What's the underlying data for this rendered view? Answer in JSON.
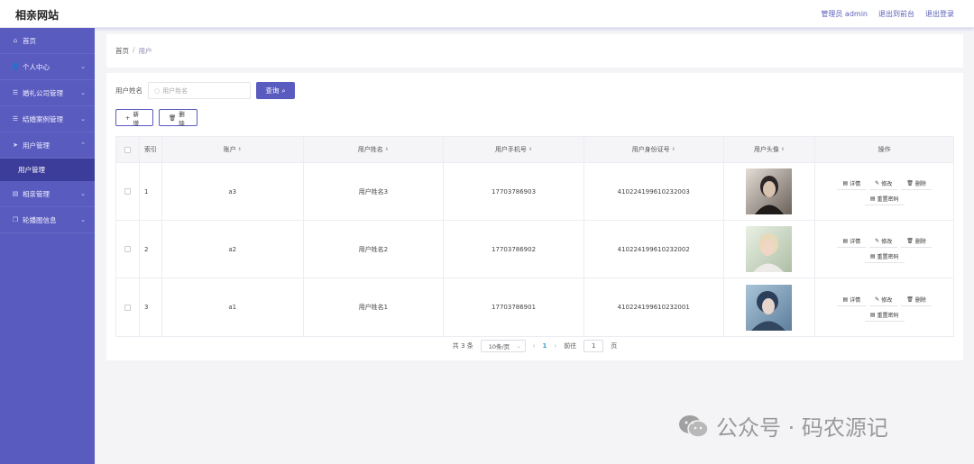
{
  "header": {
    "brand": "相亲网站",
    "admin_label": "管理员 admin",
    "back_label": "退出到前台",
    "logout_label": "退出登录"
  },
  "sidebar": {
    "items": [
      {
        "label": "首页",
        "icon": "home-icon"
      },
      {
        "label": "个人中心",
        "icon": "user-icon"
      },
      {
        "label": "婚礼公司管理",
        "icon": "list-icon"
      },
      {
        "label": "结婚案例管理",
        "icon": "list-icon"
      },
      {
        "label": "用户管理",
        "icon": "send-icon"
      },
      {
        "label": "相亲管理",
        "icon": "chat-icon"
      },
      {
        "label": "轮播图信息",
        "icon": "copy-icon"
      }
    ],
    "active_sub": "用户管理"
  },
  "breadcrumb": {
    "home": "首页",
    "sep": "/",
    "current": "用户"
  },
  "search": {
    "label": "用户姓名",
    "placeholder": "用户姓名",
    "button": "查询"
  },
  "actions": {
    "add": "新增",
    "delete": "删除"
  },
  "table": {
    "headers": {
      "index": "索引",
      "account": "账户",
      "name": "用户姓名",
      "phone": "用户手机号",
      "idcard": "用户身份证号",
      "avatar": "用户头像",
      "ops": "操作"
    },
    "ops": {
      "detail": "详情",
      "edit": "修改",
      "delete": "删除",
      "reset": "重置密码"
    },
    "rows": [
      {
        "index": "1",
        "account": "a3",
        "name": "用户姓名3",
        "phone": "17703786903",
        "idcard": "410224199610232003"
      },
      {
        "index": "2",
        "account": "a2",
        "name": "用户姓名2",
        "phone": "17703786902",
        "idcard": "410224199610232002"
      },
      {
        "index": "3",
        "account": "a1",
        "name": "用户姓名1",
        "phone": "17703786901",
        "idcard": "410224199610232001"
      }
    ]
  },
  "pager": {
    "total": "共 3 条",
    "page_size": "10条/页",
    "current": "1",
    "goto_prefix": "前往",
    "goto_value": "1",
    "goto_suffix": "页"
  },
  "watermark": {
    "text": "公众号 · 码农源记"
  },
  "colors": {
    "sidebar": "#5a5bbf",
    "sidebar_active": "#3c3c9a",
    "accent": "#5a5bbf"
  }
}
